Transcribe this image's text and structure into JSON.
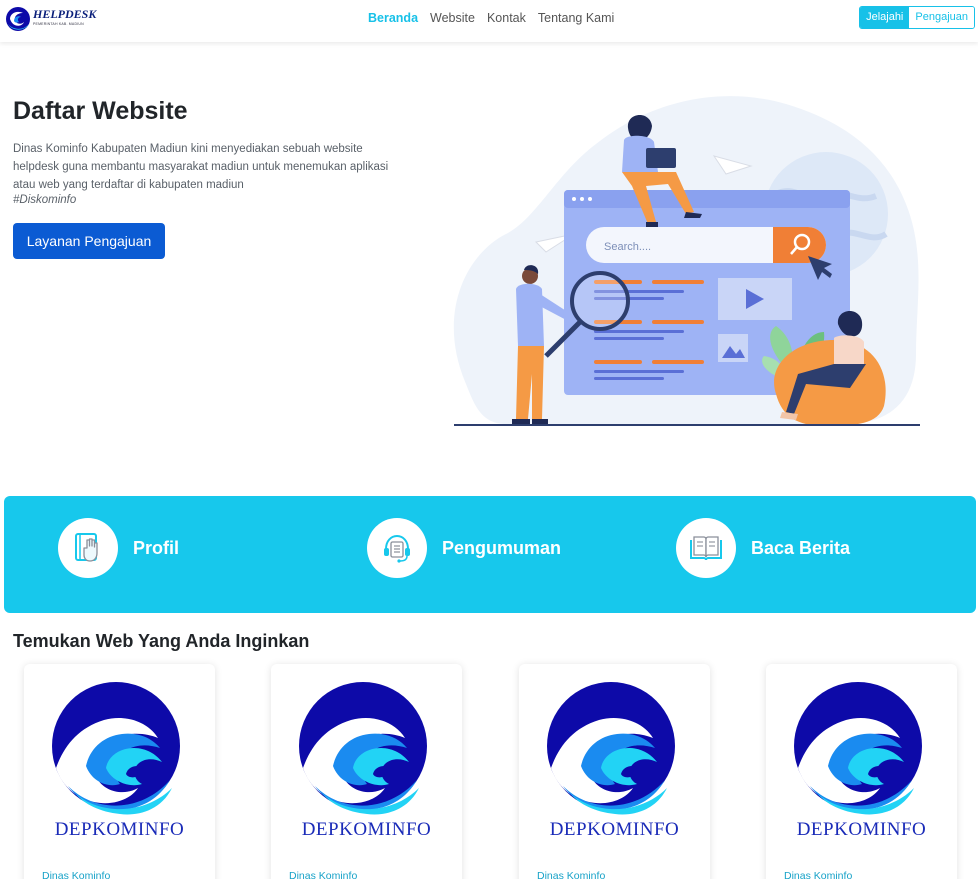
{
  "brand": {
    "name": "HELPDESK",
    "tagline": "PEMERINTAH KAB. MADIUN"
  },
  "nav": {
    "links": [
      {
        "label": "Beranda",
        "active": true
      },
      {
        "label": "Website",
        "active": false
      },
      {
        "label": "Kontak",
        "active": false
      },
      {
        "label": "Tentang Kami",
        "active": false
      }
    ],
    "buttons": {
      "primary": "Jelajahi",
      "secondary": "Pengajuan"
    }
  },
  "hero": {
    "title": "Daftar Website",
    "description": "Dinas Kominfo Kabupaten Madiun kini menyediakan sebuah website helpdesk guna membantu masyarakat madiun untuk menemukan aplikasi atau web yang terdaftar di kabupaten madiun",
    "hashtag": "#Diskominfo",
    "button": "Layanan Pengajuan",
    "illustration": {
      "search_placeholder": "Search...."
    }
  },
  "features": [
    {
      "label": "Profil",
      "icon": "hand-book-icon"
    },
    {
      "label": "Pengumuman",
      "icon": "headset-icon"
    },
    {
      "label": "Baca Berita",
      "icon": "open-book-icon"
    }
  ],
  "section": {
    "title": "Temukan Web Yang Anda Inginkan"
  },
  "cards": [
    {
      "name": "DEPKOMINFO",
      "subtitle": "Dinas Kominfo"
    },
    {
      "name": "DEPKOMINFO",
      "subtitle": "Dinas Kominfo"
    },
    {
      "name": "DEPKOMINFO",
      "subtitle": "Dinas Kominfo"
    },
    {
      "name": "DEPKOMINFO",
      "subtitle": "Dinas Kominfo"
    }
  ],
  "colors": {
    "accent": "#17c1e8",
    "band": "#17c8ec",
    "primary_button": "#0b5bd3",
    "logo_dark": "#0d0aa8",
    "logo_mid": "#1a8bf0",
    "logo_light": "#22d3f5"
  }
}
